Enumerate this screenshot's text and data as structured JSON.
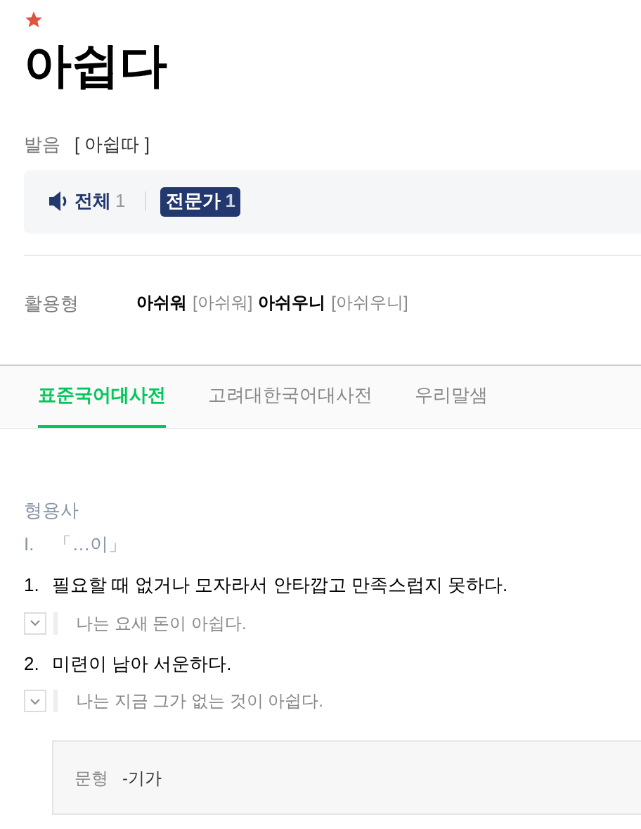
{
  "entry": {
    "important": true,
    "headword": "아쉽다"
  },
  "pronunciation": {
    "label": "발음",
    "value": "[ 아쉽따 ]"
  },
  "audio_filters": [
    {
      "label": "전체",
      "count": "1",
      "selected": false
    },
    {
      "label": "전문가",
      "count": "1",
      "selected": true
    }
  ],
  "conjugation": {
    "label": "활용형",
    "forms": [
      {
        "word": "아쉬워",
        "pron": "[아쉬워]"
      },
      {
        "word": "아쉬우니",
        "pron": "[아쉬우니]"
      }
    ]
  },
  "tabs": [
    {
      "label": "표준국어대사전",
      "selected": true
    },
    {
      "label": "고려대한국어대사전",
      "selected": false
    },
    {
      "label": "우리말샘",
      "selected": false
    }
  ],
  "pos": "형용사",
  "group": {
    "numeral": "I.",
    "pattern": "「…이」"
  },
  "senses": [
    {
      "number": "1.",
      "definition": "필요할 때 없거나 모자라서 안타깝고 만족스럽지 못하다.",
      "example": "나는 요새 돈이 아쉽다."
    },
    {
      "number": "2.",
      "definition": "미련이 남아 서운하다.",
      "example": "나는 지금 그가 없는 것이 아쉽다."
    }
  ],
  "pattern_box": {
    "label": "문형",
    "value": "-기가"
  }
}
